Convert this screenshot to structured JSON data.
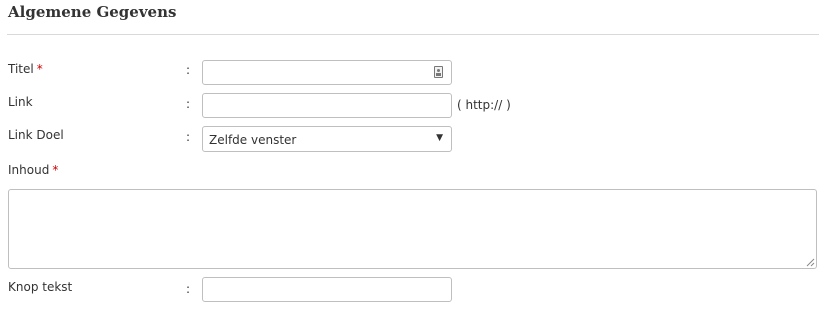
{
  "section": {
    "title": "Algemene Gegevens"
  },
  "form": {
    "colon": ":",
    "required_marker": "*",
    "titel": {
      "label": "Titel",
      "value": "",
      "icon": "contact-card-icon"
    },
    "link": {
      "label": "Link",
      "value": "",
      "hint": "( http:// )"
    },
    "link_doel": {
      "label": "Link Doel",
      "selected": "Zelfde venster",
      "arrow": "▼"
    },
    "inhoud": {
      "label": "Inhoud",
      "value": ""
    },
    "knop_tekst": {
      "label": "Knop tekst",
      "value": ""
    }
  }
}
